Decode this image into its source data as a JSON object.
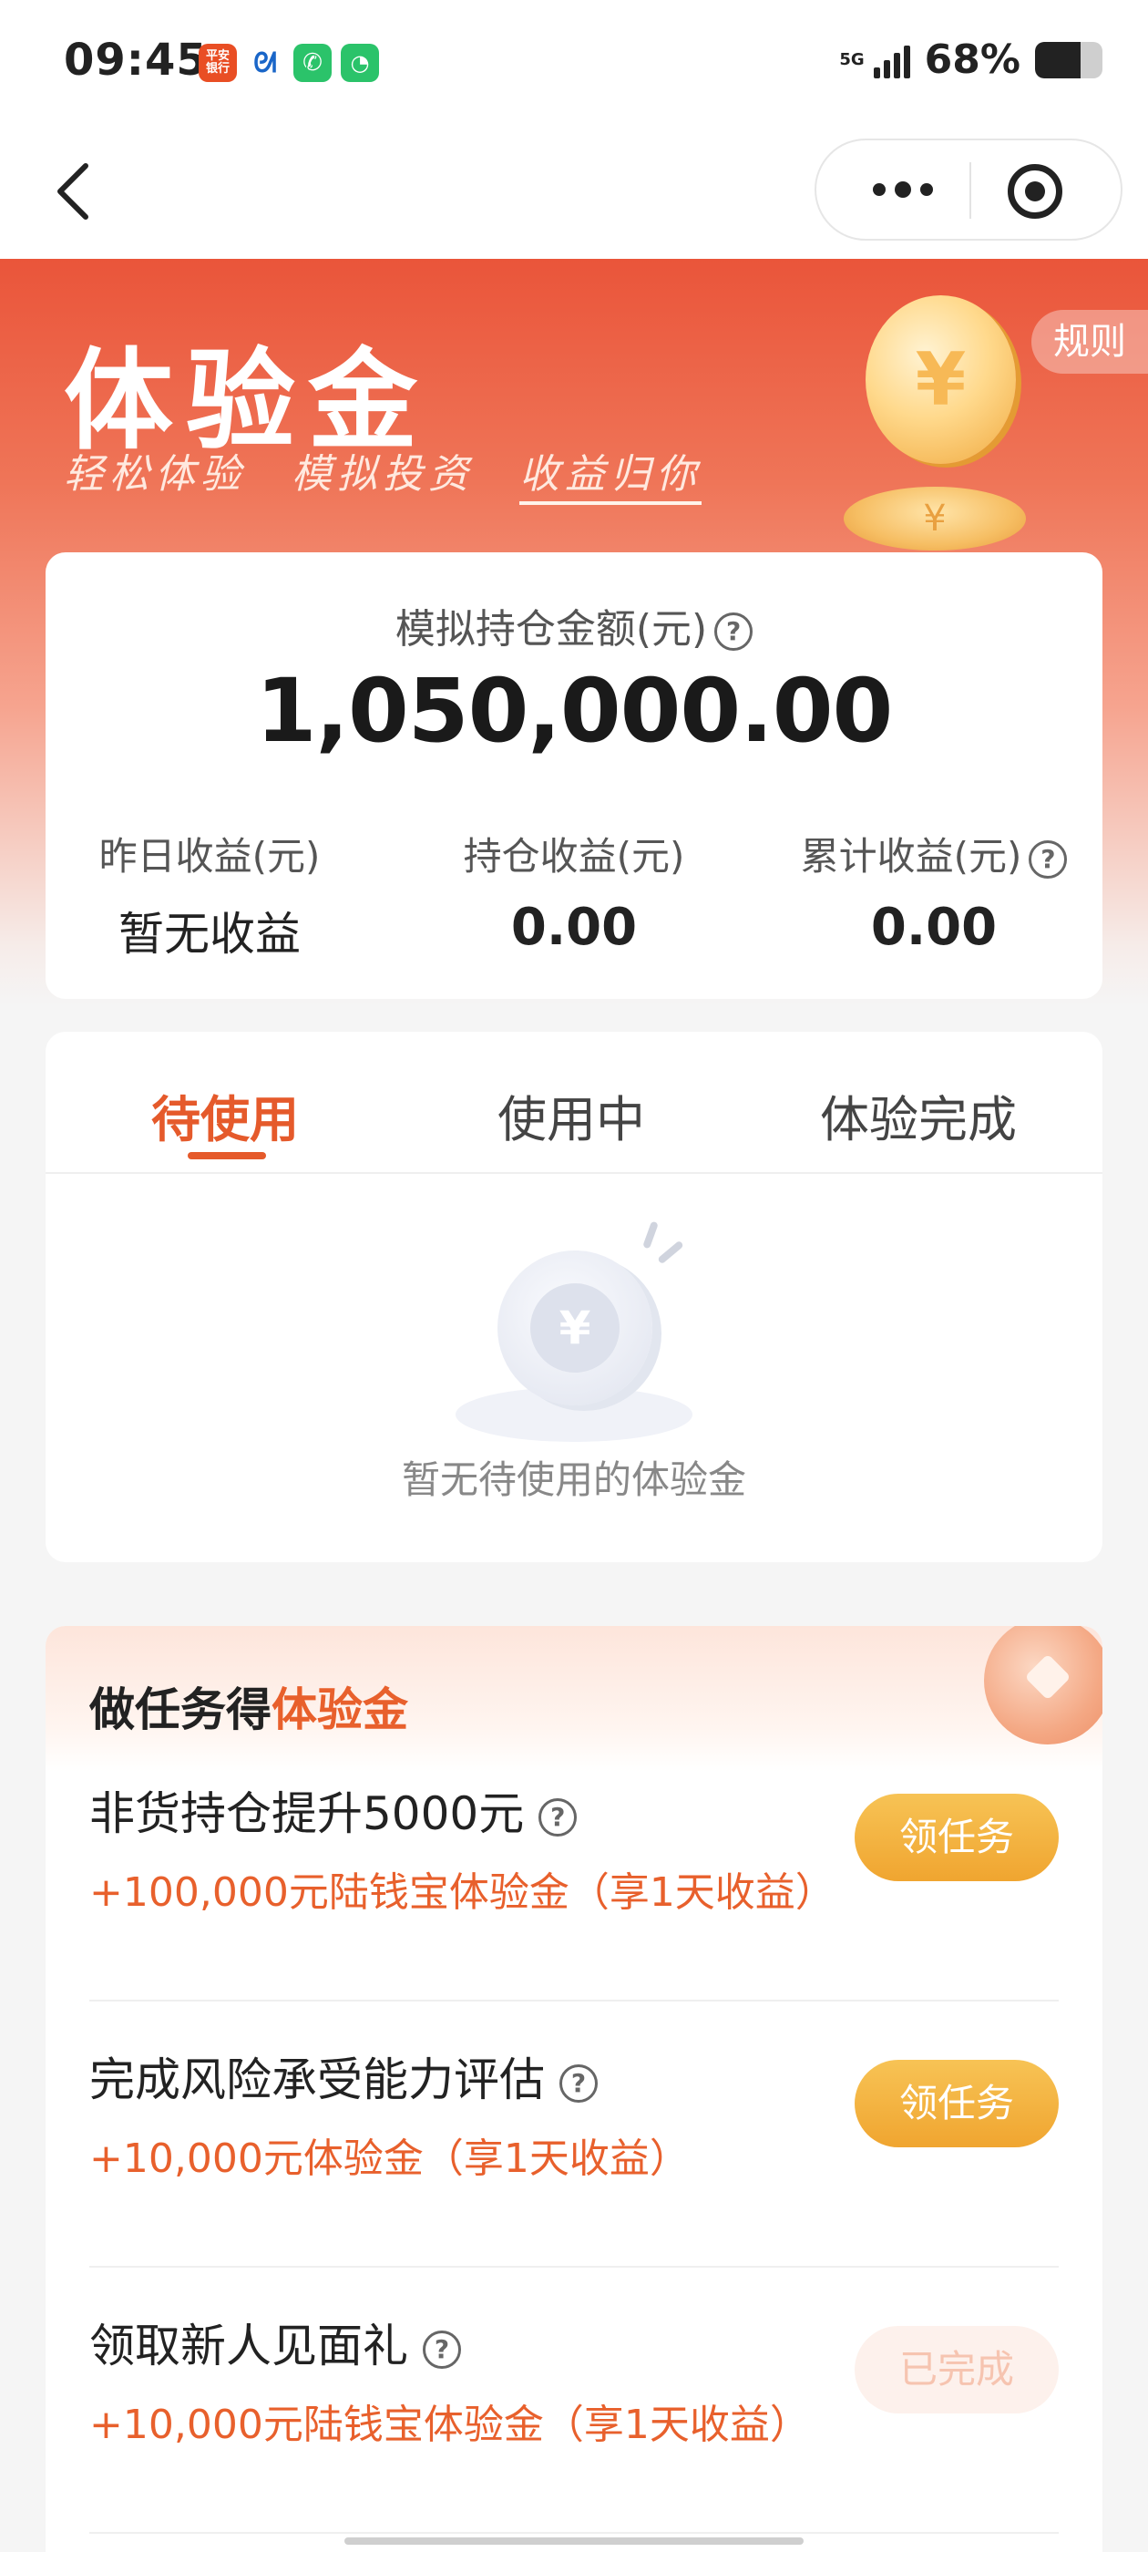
{
  "status_bar": {
    "time": "09:45",
    "app_icons": [
      {
        "name": "pingan-bank-icon",
        "label": "平安\n银行"
      },
      {
        "name": "fish-app-icon",
        "label": ""
      },
      {
        "name": "phone-app-icon",
        "label": ""
      },
      {
        "name": "wechat-icon",
        "label": ""
      }
    ],
    "network": "5G",
    "battery_percent": "68%",
    "battery_level": 0.68
  },
  "nav": {
    "back_icon": "chevron-left-icon",
    "more_icon": "more-dots-icon",
    "close_icon": "target-close-icon"
  },
  "hero": {
    "title": "体验金",
    "slogans": [
      "轻松体验",
      "模拟投资",
      "收益归你"
    ],
    "rules_label": "规则",
    "coin_symbol": "¥"
  },
  "summary": {
    "label": "模拟持仓金额(元)",
    "value": "1,050,000.00",
    "help_icon": "question-circle-icon",
    "stats": [
      {
        "label": "昨日收益(元)",
        "value": "暂无收益",
        "help": false
      },
      {
        "label": "持仓收益(元)",
        "value": "0.00",
        "help": false
      },
      {
        "label": "累计收益(元)",
        "value": "0.00",
        "help": true
      }
    ]
  },
  "tabs": {
    "items": [
      "待使用",
      "使用中",
      "体验完成"
    ],
    "active_index": 0,
    "empty_text": "暂无待使用的体验金",
    "empty_coin_symbol": "¥"
  },
  "tasks": {
    "title_prefix": "做任务得",
    "title_accent": "体验金",
    "items": [
      {
        "title": "非货持仓提升5000元",
        "reward": "+100,000元陆钱宝体验金（享1天收益）",
        "button": "领任务",
        "done": false
      },
      {
        "title": "完成风险承受能力评估",
        "reward": "+10,000元体验金（享1天收益）",
        "button": "领任务",
        "done": false
      },
      {
        "title": "领取新人见面礼",
        "reward": "+10,000元陆钱宝体验金（享1天收益）",
        "button": "已完成",
        "done": true
      }
    ]
  },
  "colors": {
    "brand_orange": "#e55a2b",
    "reward_orange": "#e8602c",
    "button_gold": "#f0a530",
    "hero_red": "#ea553a"
  }
}
